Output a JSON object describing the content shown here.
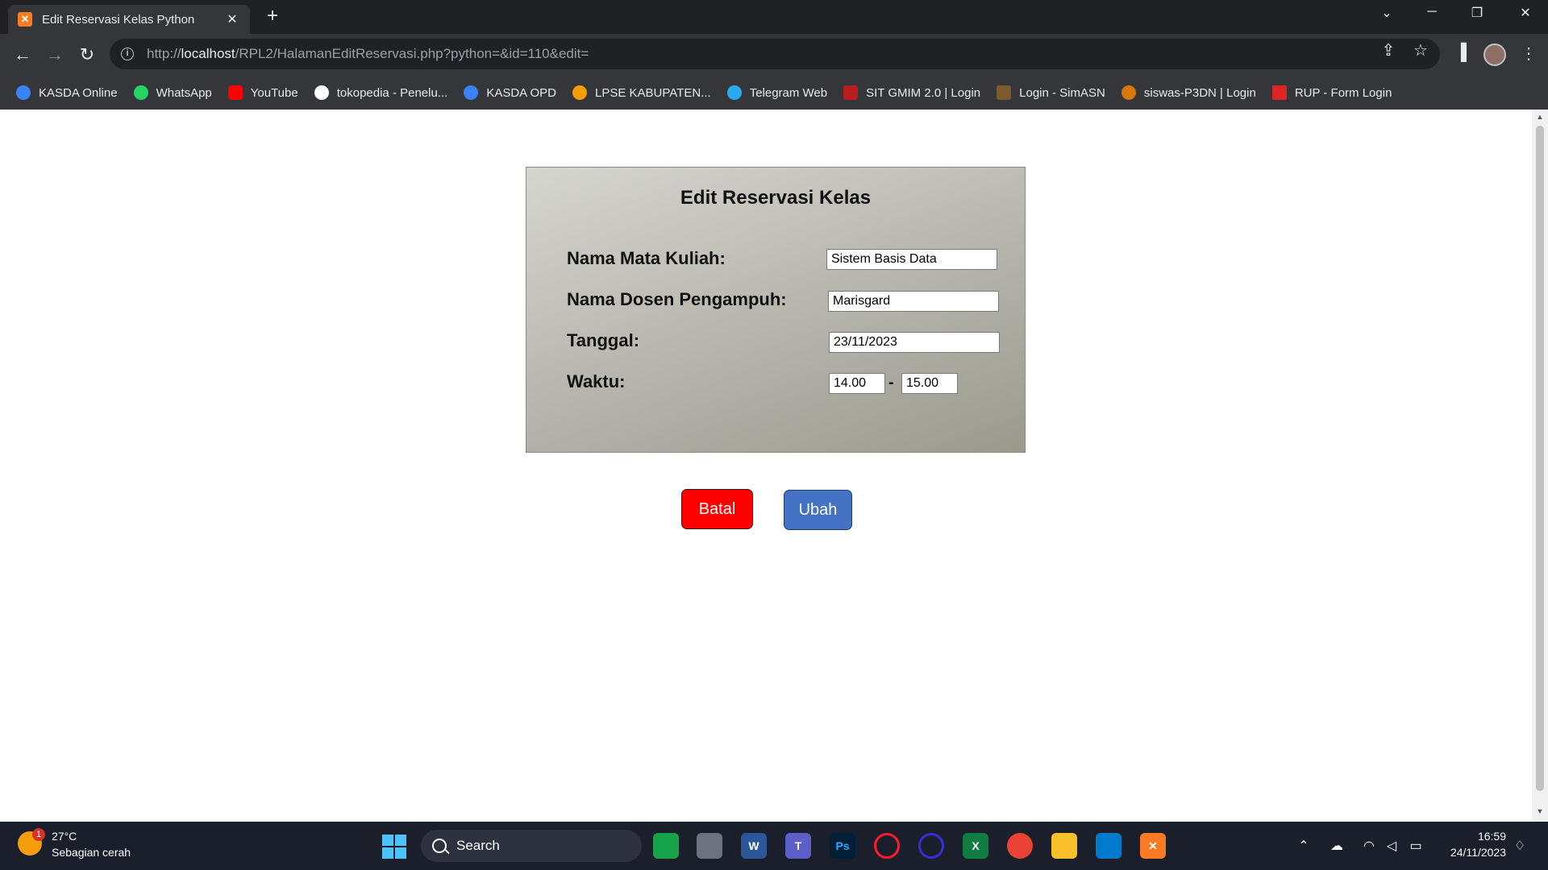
{
  "browser": {
    "tab_title": "Edit Reservasi Kelas Python",
    "tab_close": "✕",
    "new_tab": "+",
    "url_prefix": "http://",
    "url_host": "localhost",
    "url_path": "/RPL2/HalamanEditReservasi.php?python=&id=110&edit=",
    "bookmarks": [
      {
        "label": "KASDA Online",
        "color": "#3b82f6"
      },
      {
        "label": "WhatsApp",
        "color": "#25d366"
      },
      {
        "label": "YouTube",
        "color": "#ff0000"
      },
      {
        "label": "tokopedia - Penelu...",
        "color": "#ffffff"
      },
      {
        "label": "KASDA OPD",
        "color": "#3b82f6"
      },
      {
        "label": "LPSE KABUPATEN...",
        "color": "#f59e0b"
      },
      {
        "label": "Telegram Web",
        "color": "#2aabee"
      },
      {
        "label": "SIT GMIM 2.0 | Login",
        "color": "#b91c1c"
      },
      {
        "label": "Login - SimASN",
        "color": "#7c5c2e"
      },
      {
        "label": "siswas-P3DN | Login",
        "color": "#d97706"
      },
      {
        "label": "RUP - Form Login",
        "color": "#dc2626"
      }
    ]
  },
  "form": {
    "title": "Edit Reservasi Kelas",
    "mata_kuliah_label": "Nama Mata Kuliah:",
    "mata_kuliah_value": "Sistem Basis Data",
    "dosen_label": "Nama Dosen Pengampuh:",
    "dosen_value": "Marisgard",
    "tanggal_label": "Tanggal:",
    "tanggal_value": "23/11/2023",
    "waktu_label": "Waktu:",
    "waktu_start": "14.00",
    "waktu_separator": "-",
    "waktu_end": "15.00",
    "batal_label": "Batal",
    "ubah_label": "Ubah",
    "batal_color": "#ff0000",
    "ubah_color": "#4472c4"
  },
  "taskbar": {
    "weather_temp": "27°C",
    "weather_desc": "Sebagian cerah",
    "weather_badge": "1",
    "search_label": "Search",
    "time": "16:59",
    "date": "24/11/2023"
  }
}
